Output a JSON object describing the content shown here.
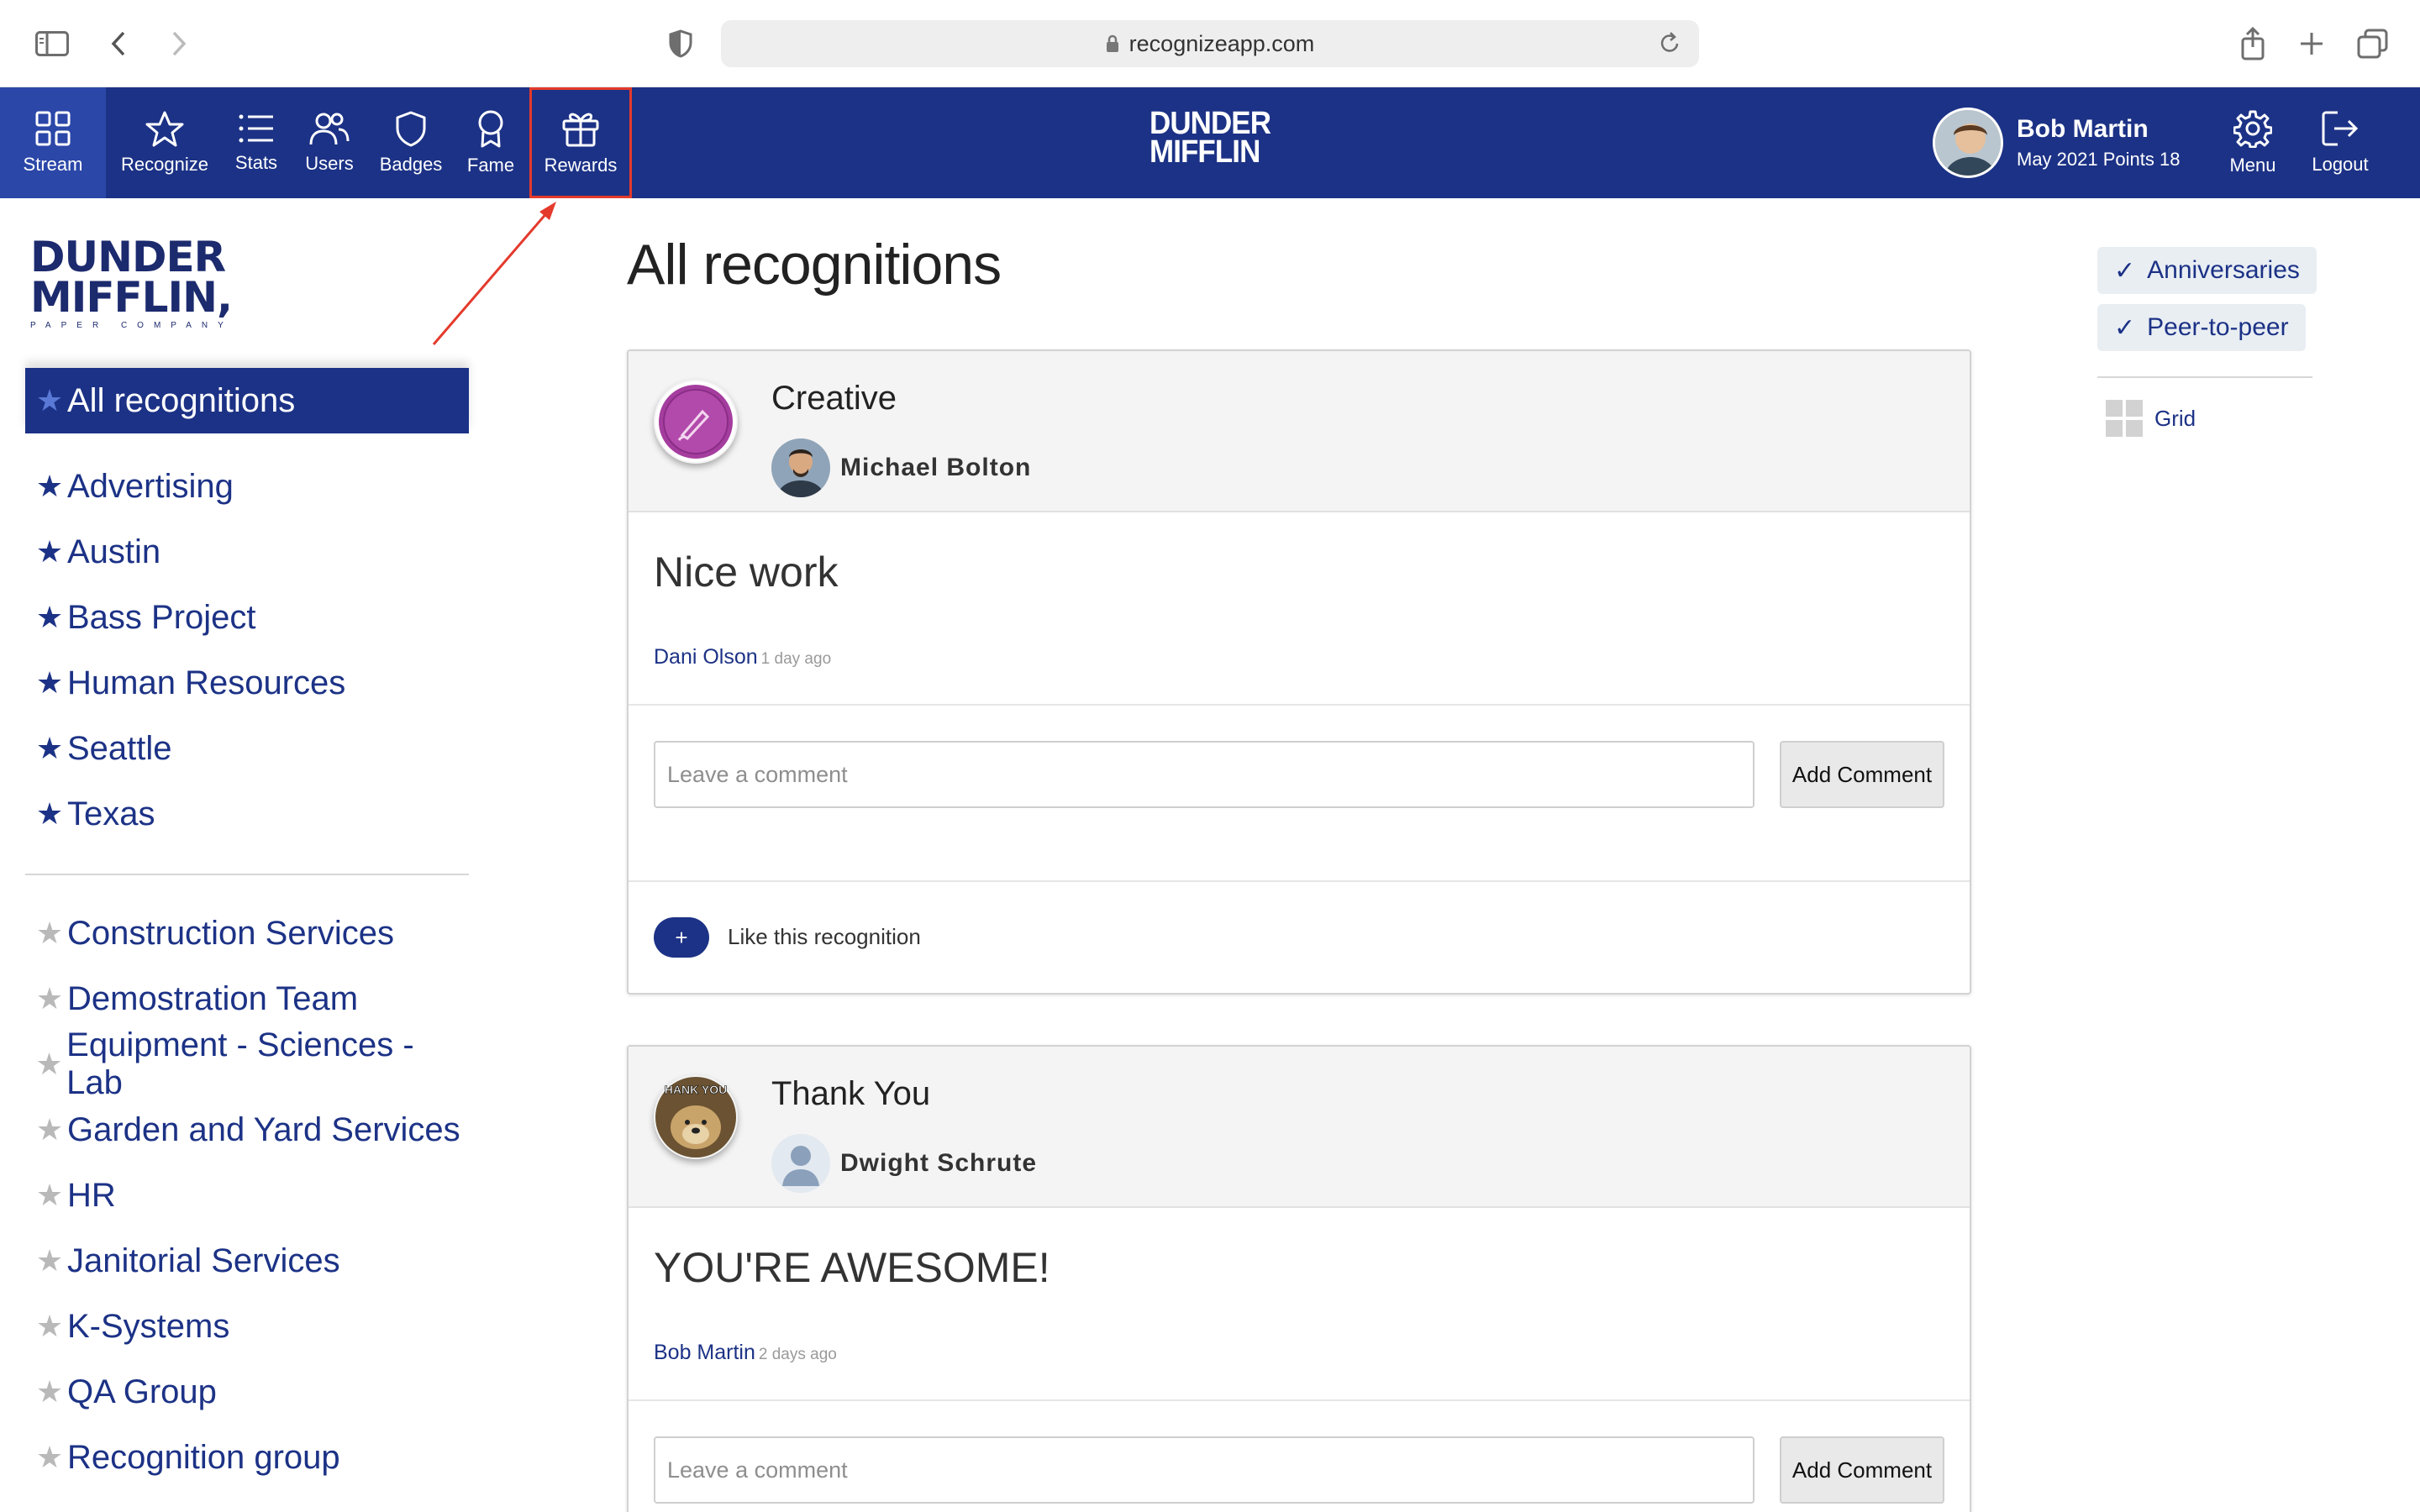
{
  "browser": {
    "url": "recognizeapp.com"
  },
  "nav": {
    "items": [
      {
        "label": "Stream",
        "icon": "grid-icon"
      },
      {
        "label": "Recognize",
        "icon": "star-icon"
      },
      {
        "label": "Stats",
        "icon": "list-icon"
      },
      {
        "label": "Users",
        "icon": "users-icon"
      },
      {
        "label": "Badges",
        "icon": "shield-icon"
      },
      {
        "label": "Fame",
        "icon": "award-icon"
      },
      {
        "label": "Rewards",
        "icon": "gift-icon"
      }
    ],
    "logo_line1": "DUNDER",
    "logo_line2": "MIFFLIN",
    "user_name": "Bob Martin",
    "user_points": "May 2021 Points 18",
    "menu_label": "Menu",
    "logout_label": "Logout"
  },
  "sidebar": {
    "logo_line1": "DUNDER",
    "logo_line2": "MIFFLIN,",
    "logo_tagline": "PAPER COMPANY",
    "active": "All recognitions",
    "favorites": [
      "Advertising",
      "Austin",
      "Bass Project",
      "Human Resources",
      "Seattle",
      "Texas"
    ],
    "others": [
      "Construction Services",
      "Demostration Team",
      "Equipment - Sciences - Lab",
      "Garden and Yard Services",
      "HR",
      "Janitorial Services",
      "K-Systems",
      "QA Group",
      "Recognition group"
    ]
  },
  "main": {
    "title": "All recognitions",
    "cards": [
      {
        "badge": "Creative",
        "recipient": "Michael Bolton",
        "message": "Nice work",
        "sender": "Dani Olson",
        "time_ago": "1 day ago",
        "comment_placeholder": "Leave a comment",
        "comment_button": "Add Comment",
        "like_label": "Like this recognition",
        "like_symbol": "+"
      },
      {
        "badge": "Thank You",
        "badge_image_text": "HANK YOU",
        "recipient": "Dwight Schrute",
        "message": "YOU'RE AWESOME!",
        "sender": "Bob Martin",
        "time_ago": "2 days ago",
        "comment_placeholder": "Leave a comment",
        "comment_button": "Add Comment"
      }
    ]
  },
  "rail": {
    "filters": [
      {
        "label": "Anniversaries",
        "check": "✓"
      },
      {
        "label": "Peer-to-peer",
        "check": "✓"
      }
    ],
    "view_toggle": "Grid"
  },
  "colors": {
    "brand_navy": "#1c3286",
    "highlight": "#e43a2c"
  }
}
